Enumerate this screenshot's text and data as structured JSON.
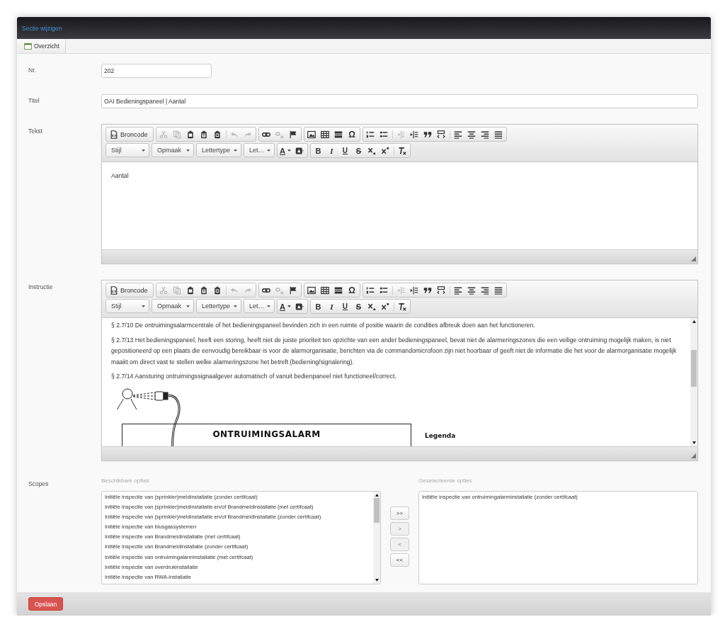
{
  "window": {
    "title": "Sectie wijzigen"
  },
  "toolbar": [
    {
      "label": "Overzicht"
    }
  ],
  "form": {
    "fields": [
      {
        "label": "Nr.",
        "kind": "short",
        "value": "202"
      },
      {
        "label": "Titel",
        "kind": "wide",
        "value": "OAI Bedieningspaneel | Aantal"
      }
    ],
    "editors": [
      {
        "label": "Tekst",
        "scrollbar": false,
        "toolbar": [
          [
            [
              {
                "kind": "source",
                "label": "Broncode",
                "disabled": false
              }
            ],
            [
              {
                "kind": "cut",
                "disabled": true
              },
              {
                "kind": "copy",
                "disabled": true
              },
              {
                "kind": "paste",
                "disabled": false
              },
              {
                "kind": "pastetext",
                "disabled": false
              },
              {
                "kind": "pasteword",
                "disabled": false
              },
              {
                "kind": "separator"
              },
              {
                "kind": "undo",
                "disabled": true
              },
              {
                "kind": "redo",
                "disabled": true
              }
            ],
            [
              {
                "kind": "link",
                "disabled": false
              },
              {
                "kind": "unlink",
                "disabled": true
              },
              {
                "kind": "anchor",
                "disabled": false
              }
            ],
            [
              {
                "kind": "image",
                "disabled": false
              },
              {
                "kind": "table",
                "disabled": false
              },
              {
                "kind": "rule",
                "disabled": false
              },
              {
                "kind": "glyph",
                "label": "Ω",
                "disabled": false
              }
            ],
            [
              {
                "kind": "numbered",
                "disabled": false
              },
              {
                "kind": "bulleted",
                "disabled": false
              },
              {
                "kind": "separator"
              },
              {
                "kind": "outdent",
                "disabled": true
              },
              {
                "kind": "indent",
                "disabled": false
              },
              {
                "kind": "quote",
                "disabled": false
              },
              {
                "kind": "div",
                "disabled": false
              },
              {
                "kind": "separator"
              },
              {
                "kind": "alignleft",
                "disabled": false
              },
              {
                "kind": "aligncenter",
                "disabled": false
              },
              {
                "kind": "alignright",
                "disabled": false
              },
              {
                "kind": "justify",
                "disabled": false
              }
            ]
          ],
          [
            [
              {
                "kind": "combo",
                "label": "Stijl",
                "disabled": false
              }
            ],
            [
              {
                "kind": "combo",
                "label": "Opmaak",
                "disabled": false
              }
            ],
            [
              {
                "kind": "combo",
                "label": "Lettertype",
                "disabled": false
              }
            ],
            [
              {
                "kind": "combo",
                "label": "Let…",
                "disabled": false
              }
            ],
            [
              {
                "kind": "textcolor",
                "label": "A",
                "disabled": false
              },
              {
                "kind": "bgcolor",
                "disabled": false
              }
            ],
            [
              {
                "kind": "bold",
                "label": "B",
                "disabled": false
              },
              {
                "kind": "italic",
                "label": "I",
                "disabled": false
              },
              {
                "kind": "underline",
                "label": "U",
                "disabled": false
              },
              {
                "kind": "strike",
                "label": "S",
                "disabled": false
              },
              {
                "kind": "sub",
                "disabled": false
              },
              {
                "kind": "sup",
                "disabled": false
              },
              {
                "kind": "separator"
              },
              {
                "kind": "removeformat",
                "disabled": false
              }
            ]
          ]
        ],
        "paragraphs": [
          "Aantal"
        ]
      },
      {
        "label": "Instructie",
        "scrollbar": true,
        "toolbar": [
          [
            [
              {
                "kind": "source",
                "label": "Broncode",
                "disabled": false
              }
            ],
            [
              {
                "kind": "cut",
                "disabled": true
              },
              {
                "kind": "copy",
                "disabled": true
              },
              {
                "kind": "paste",
                "disabled": false
              },
              {
                "kind": "pastetext",
                "disabled": false
              },
              {
                "kind": "pasteword",
                "disabled": false
              },
              {
                "kind": "separator"
              },
              {
                "kind": "undo",
                "disabled": true
              },
              {
                "kind": "redo",
                "disabled": true
              }
            ],
            [
              {
                "kind": "link",
                "disabled": false
              },
              {
                "kind": "unlink",
                "disabled": true
              },
              {
                "kind": "anchor",
                "disabled": false
              }
            ],
            [
              {
                "kind": "image",
                "disabled": false
              },
              {
                "kind": "table",
                "disabled": false
              },
              {
                "kind": "rule",
                "disabled": false
              },
              {
                "kind": "glyph",
                "label": "Ω",
                "disabled": false
              }
            ],
            [
              {
                "kind": "numbered",
                "disabled": false
              },
              {
                "kind": "bulleted",
                "disabled": false
              },
              {
                "kind": "separator"
              },
              {
                "kind": "outdent",
                "disabled": true
              },
              {
                "kind": "indent",
                "disabled": false
              },
              {
                "kind": "quote",
                "disabled": false
              },
              {
                "kind": "div",
                "disabled": false
              },
              {
                "kind": "separator"
              },
              {
                "kind": "alignleft",
                "disabled": false
              },
              {
                "kind": "aligncenter",
                "disabled": false
              },
              {
                "kind": "alignright",
                "disabled": false
              },
              {
                "kind": "justify",
                "disabled": false
              }
            ]
          ],
          [
            [
              {
                "kind": "combo",
                "label": "Stijl",
                "disabled": false
              }
            ],
            [
              {
                "kind": "combo",
                "label": "Opmaak",
                "disabled": false
              }
            ],
            [
              {
                "kind": "combo",
                "label": "Lettertype",
                "disabled": false
              }
            ],
            [
              {
                "kind": "combo",
                "label": "Let…",
                "disabled": false
              }
            ],
            [
              {
                "kind": "textcolor",
                "label": "A",
                "disabled": false
              },
              {
                "kind": "bgcolor",
                "disabled": false
              }
            ],
            [
              {
                "kind": "bold",
                "label": "B",
                "disabled": false
              },
              {
                "kind": "italic",
                "label": "I",
                "disabled": false
              },
              {
                "kind": "underline",
                "label": "U",
                "disabled": false
              },
              {
                "kind": "strike",
                "label": "S",
                "disabled": false
              },
              {
                "kind": "sub",
                "disabled": false
              },
              {
                "kind": "sup",
                "disabled": false
              },
              {
                "kind": "separator"
              },
              {
                "kind": "removeformat",
                "disabled": false
              }
            ]
          ]
        ],
        "paragraphs": [
          "§ 2.7/10 De ontruimingsalarmcentrale of het bedieningspaneel bevinden zich in een ruimte of positie waarin de condities afbreuk doen aan het functioneren.",
          "§ 2.7/13 Het bedieningspaneel, heeft een storing, heeft niet de juiste prioriteit ten opzichte van een ander bedieningspaneel, bevat niet de alarmeringszones die een veilige ontruiming mogelijk maken, is niet gepositioneerd op een plaats die eenvoudig bereikbaar is voor de alarmorganisatie, berichten via de commandomicrofoon zijn niet hoorbaar of geeft niet de informatie die het voor de alarmorganisatie mogelijk maakt om direct vast te stellen welke alarmeringszone het betreft (bediening/signalering).",
          "§ 2.7/14 Aansturing ontruimingssignaalgever automatisch of vanuit bedienpaneel niet functioneel/correct."
        ],
        "figure": {
          "title": "ONTRUIMINGSALARM",
          "legend": "Legenda"
        }
      }
    ],
    "scopes": {
      "label": "Scopes",
      "available": {
        "title": "Beschikbare opties",
        "items": [
          "Initiële inspectie van (sprinkler)meldinstallatie (zonder certifcaat)",
          "Initiële inspectie van (sprinkler)meldinstallatie en/of Brandmeldinstallatie (met certifcaat)",
          "Initiële inspectie van (sprinkler)meldinstallatie en/of Brandmeldinstallatie (zonder certifcaat)",
          "Initiële inspectie van blusgassystemen",
          "Initiële inspectie van Brandmeldinstallatie (met certifcaat)",
          "Initiële inspectie van Brandmeldinstallatie (zonder certifcaat)",
          "Initiële inspectie van ontruimingalarminstallatie (met certifcaat)",
          "Initiële inspectie van overdrukinstallatie",
          "Initiële inspectie van RWA-installatie"
        ]
      },
      "buttons": [
        {
          "label": ">>",
          "disabled": false
        },
        {
          "label": ">",
          "disabled": true
        },
        {
          "label": "<",
          "disabled": true
        },
        {
          "label": "<<",
          "disabled": false
        }
      ],
      "selected": {
        "title": "Geselecteerde opties",
        "items": [
          "Initiële inspectie van ontruimingalarminstallatie (zonder certifcaat)"
        ]
      }
    }
  },
  "actions": [
    {
      "label": "Opslaan",
      "kind": "primary"
    }
  ]
}
